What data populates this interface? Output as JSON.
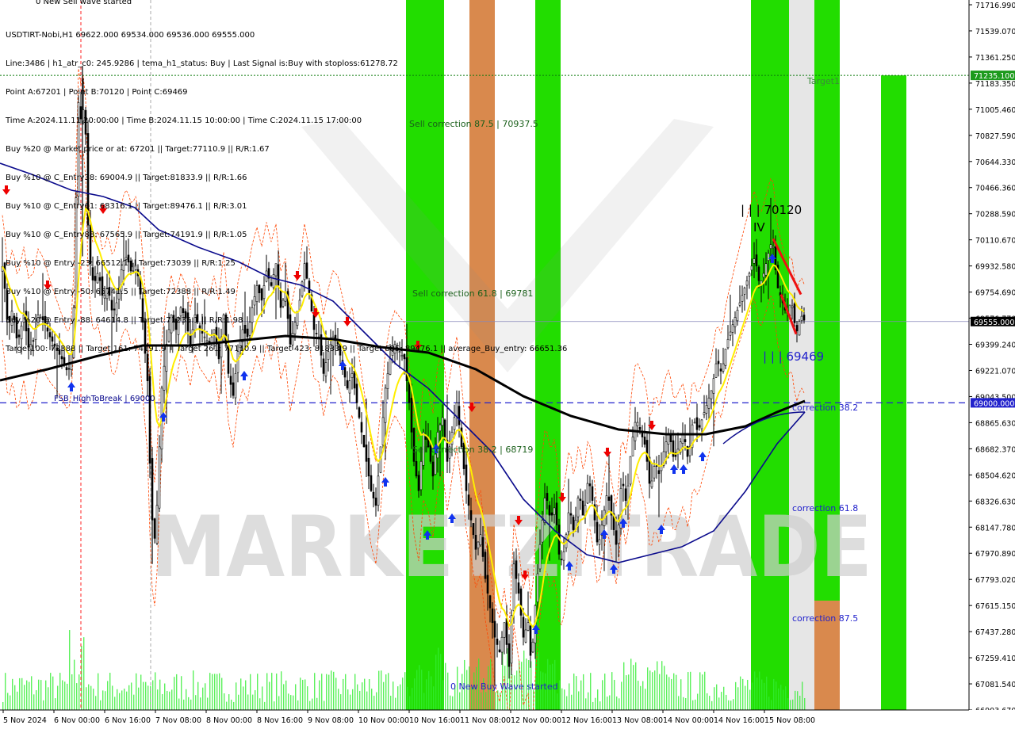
{
  "header": {
    "symbol_line": "USDTIRT-Nobi,H1 69622.000 69534.000 69536.000 69555.000",
    "lines": [
      "Line:3486 | h1_atr_c0: 245.9286 | tema_h1_status: Buy | Last Signal is:Buy with stoploss:61278.72",
      "Point A:67201 | Point B:70120 | Point C:69469",
      "Time A:2024.11.11 20:00:00 | Time B:2024.11.15 10:00:00 | Time C:2024.11.15 17:00:00",
      "Buy %20 @ Market price or at: 67201 || Target:77110.9 || R/R:1.67",
      "Buy %10 @ C_Entry38: 69004.9 || Target:81833.9 || R/R:1.66",
      "Buy %10 @ C_Entry61: 68316.1 || Target:89476.1 || R/R:3.01",
      "Buy %10 @ C_Entry88: 67565.9 || Target:74191.9 || R/R:1.05",
      "Buy %10 @ Entry -23: 66512.1 || Target:73039 || R/R:1.25",
      "Buy %10 @ Entry -50: 65741.5 || Target:72388 || R/R:1.49",
      "Buy %20 @ Entry -88: 64614.8 || Target:71235.1 || R/R:1.98",
      "Target100: 72388 || Target 161: 74191.9 || Target 261: 77110.9 || Target 423: 81833.9 || Target 685: 89476.1 || average_Buy_entry: 66651.36"
    ],
    "new_wave_label": "0 New Sell wave started"
  },
  "price_axis": {
    "labels": [
      "71716.990",
      "71539.070",
      "71361.250",
      "71183.350",
      "71005.460",
      "70827.590",
      "70644.330",
      "70466.360",
      "70288.590",
      "70110.670",
      "69932.580",
      "69754.690",
      "69576.770",
      "69399.240",
      "69221.070",
      "69043.500",
      "68865.630",
      "68682.370",
      "68504.620",
      "68326.630",
      "68147.780",
      "67970.890",
      "67793.020",
      "67615.150",
      "67437.280",
      "67259.410",
      "67081.540",
      "66903.670"
    ],
    "current_price": "69555.000",
    "target_price": "71235.100",
    "break_price": "69000.000"
  },
  "time_axis": {
    "labels": [
      "5 Nov 2024",
      "6 Nov 00:00",
      "6 Nov 16:00",
      "7 Nov 08:00",
      "8 Nov 00:00",
      "8 Nov 16:00",
      "9 Nov 08:00",
      "10 Nov 00:00",
      "10 Nov 16:00",
      "11 Nov 08:00",
      "12 Nov 00:00",
      "12 Nov 16:00",
      "13 Nov 08:00",
      "14 Nov 00:00",
      "14 Nov 16:00",
      "15 Nov 08:00"
    ]
  },
  "annotations": {
    "sell_correction_875": "Sell correction 87.5 | 70937.5",
    "sell_correction_618": "Sell correction 61.8 | 69781",
    "sell_correction_382": "Sell correction 38.2 | 68719",
    "fsb": "FSB_HighToBreak | 69000",
    "target1": "Target1",
    "point_b": "| | | 70120",
    "point_b_roman": "IV",
    "point_c": "| | | 69469",
    "correction_382": "correction 38.2",
    "correction_618": "correction 61.8",
    "correction_875": "correction 87.5",
    "new_buy_wave": "0 New Buy Wave started",
    "watermark": "MARKETZITRADE"
  },
  "colors": {
    "green_band": "#22dd00",
    "orange_band": "#d9894d",
    "candle": "#000000",
    "ema_fast": "#ffee00",
    "ema_mid": "#0a0a8c",
    "ema_slow": "#000000",
    "grid_price": "#2222cc",
    "target_line": "#0c7a0c",
    "sell_arrow": "#ee0000",
    "buy_arrow": "#1133ee",
    "stoploss_line": "#ff4400"
  },
  "chart_data": {
    "type": "candlestick",
    "symbol": "USDTIRT-Nobi",
    "timeframe": "H1",
    "ylim": [
      66903.67,
      71716.99
    ],
    "last": 69555,
    "levels": {
      "target1": 71235.1,
      "high_to_break": 69000,
      "point_a": 67201,
      "point_b": 70120,
      "point_c": 69469
    },
    "close_path": [
      [
        0,
        70080
      ],
      [
        6,
        69780
      ],
      [
        10,
        69500
      ],
      [
        16,
        69650
      ],
      [
        22,
        69400
      ],
      [
        30,
        69600
      ],
      [
        36,
        69380
      ],
      [
        42,
        69420
      ],
      [
        48,
        69600
      ],
      [
        55,
        69560
      ],
      [
        62,
        69460
      ],
      [
        70,
        69380
      ],
      [
        78,
        69300
      ],
      [
        86,
        69200
      ],
      [
        92,
        69400
      ],
      [
        96,
        70400
      ],
      [
        99,
        71050
      ],
      [
        103,
        70900
      ],
      [
        107,
        71100
      ],
      [
        110,
        70300
      ],
      [
        114,
        69950
      ],
      [
        118,
        69800
      ],
      [
        124,
        69900
      ],
      [
        130,
        69700
      ],
      [
        136,
        69800
      ],
      [
        142,
        69600
      ],
      [
        148,
        69700
      ],
      [
        154,
        69950
      ],
      [
        160,
        70000
      ],
      [
        166,
        69880
      ],
      [
        172,
        69950
      ],
      [
        178,
        69700
      ],
      [
        182,
        69400
      ],
      [
        186,
        69150
      ],
      [
        190,
        68400
      ],
      [
        194,
        68000
      ],
      [
        198,
        68300
      ],
      [
        204,
        69100
      ],
      [
        210,
        69400
      ],
      [
        216,
        69600
      ],
      [
        222,
        69500
      ],
      [
        228,
        69650
      ],
      [
        234,
        69580
      ],
      [
        240,
        69400
      ],
      [
        246,
        69600
      ],
      [
        252,
        69500
      ],
      [
        258,
        69450
      ],
      [
        264,
        69400
      ],
      [
        270,
        69500
      ],
      [
        276,
        69300
      ],
      [
        282,
        69600
      ],
      [
        288,
        69200
      ],
      [
        294,
        69050
      ],
      [
        300,
        69350
      ],
      [
        306,
        69500
      ],
      [
        312,
        69450
      ],
      [
        318,
        69650
      ],
      [
        324,
        69800
      ],
      [
        330,
        69700
      ],
      [
        336,
        69900
      ],
      [
        342,
        69800
      ],
      [
        348,
        69950
      ],
      [
        354,
        69650
      ],
      [
        360,
        69750
      ],
      [
        366,
        69400
      ],
      [
        372,
        69550
      ],
      [
        378,
        69700
      ],
      [
        384,
        69950
      ],
      [
        390,
        69750
      ],
      [
        396,
        69500
      ],
      [
        402,
        69450
      ],
      [
        408,
        69200
      ],
      [
        414,
        69350
      ],
      [
        420,
        69450
      ],
      [
        426,
        69400
      ],
      [
        432,
        69250
      ],
      [
        438,
        69100
      ],
      [
        444,
        69200
      ],
      [
        450,
        69000
      ],
      [
        456,
        68800
      ],
      [
        462,
        68600
      ],
      [
        468,
        68400
      ],
      [
        474,
        68300
      ],
      [
        480,
        68700
      ],
      [
        486,
        69100
      ],
      [
        492,
        69300
      ],
      [
        498,
        69400
      ],
      [
        504,
        69350
      ],
      [
        510,
        69300
      ],
      [
        516,
        69000
      ],
      [
        522,
        68600
      ],
      [
        528,
        68400
      ],
      [
        534,
        68800
      ],
      [
        540,
        68700
      ],
      [
        546,
        68500
      ],
      [
        552,
        68800
      ],
      [
        558,
        68900
      ],
      [
        564,
        68600
      ],
      [
        570,
        68800
      ],
      [
        576,
        69000
      ],
      [
        582,
        68700
      ],
      [
        588,
        68400
      ],
      [
        594,
        68200
      ],
      [
        600,
        68000
      ],
      [
        606,
        68100
      ],
      [
        612,
        67800
      ],
      [
        618,
        67600
      ],
      [
        624,
        67400
      ],
      [
        630,
        67300
      ],
      [
        636,
        67500
      ],
      [
        642,
        67200
      ],
      [
        648,
        67900
      ],
      [
        654,
        67700
      ],
      [
        660,
        67400
      ],
      [
        666,
        67500
      ],
      [
        670,
        67201
      ],
      [
        676,
        67700
      ],
      [
        682,
        68100
      ],
      [
        688,
        68400
      ],
      [
        694,
        68200
      ],
      [
        700,
        68300
      ],
      [
        706,
        67900
      ],
      [
        712,
        68000
      ],
      [
        718,
        68300
      ],
      [
        724,
        68100
      ],
      [
        730,
        68400
      ],
      [
        736,
        68200
      ],
      [
        742,
        68500
      ],
      [
        748,
        68300
      ],
      [
        754,
        68000
      ],
      [
        760,
        68200
      ],
      [
        766,
        68400
      ],
      [
        772,
        68200
      ],
      [
        778,
        68000
      ],
      [
        784,
        68500
      ],
      [
        790,
        68300
      ],
      [
        796,
        68700
      ],
      [
        802,
        68900
      ],
      [
        808,
        68800
      ],
      [
        814,
        68700
      ],
      [
        820,
        68400
      ],
      [
        826,
        68600
      ],
      [
        832,
        68500
      ],
      [
        838,
        68700
      ],
      [
        844,
        68800
      ],
      [
        850,
        68600
      ],
      [
        856,
        68700
      ],
      [
        862,
        68800
      ],
      [
        868,
        68600
      ],
      [
        874,
        68900
      ],
      [
        880,
        68800
      ],
      [
        886,
        68900
      ],
      [
        892,
        69000
      ],
      [
        898,
        69100
      ],
      [
        904,
        69300
      ],
      [
        910,
        69200
      ],
      [
        916,
        69400
      ],
      [
        922,
        69500
      ],
      [
        928,
        69600
      ],
      [
        934,
        69700
      ],
      [
        940,
        69800
      ],
      [
        946,
        69900
      ],
      [
        952,
        70000
      ],
      [
        958,
        69800
      ],
      [
        964,
        69900
      ],
      [
        968,
        70000
      ],
      [
        974,
        70120
      ],
      [
        980,
        69800
      ],
      [
        986,
        69700
      ],
      [
        992,
        69600
      ],
      [
        998,
        69700
      ],
      [
        1004,
        69469
      ],
      [
        1010,
        69600
      ],
      [
        1015,
        69555
      ]
    ]
  }
}
